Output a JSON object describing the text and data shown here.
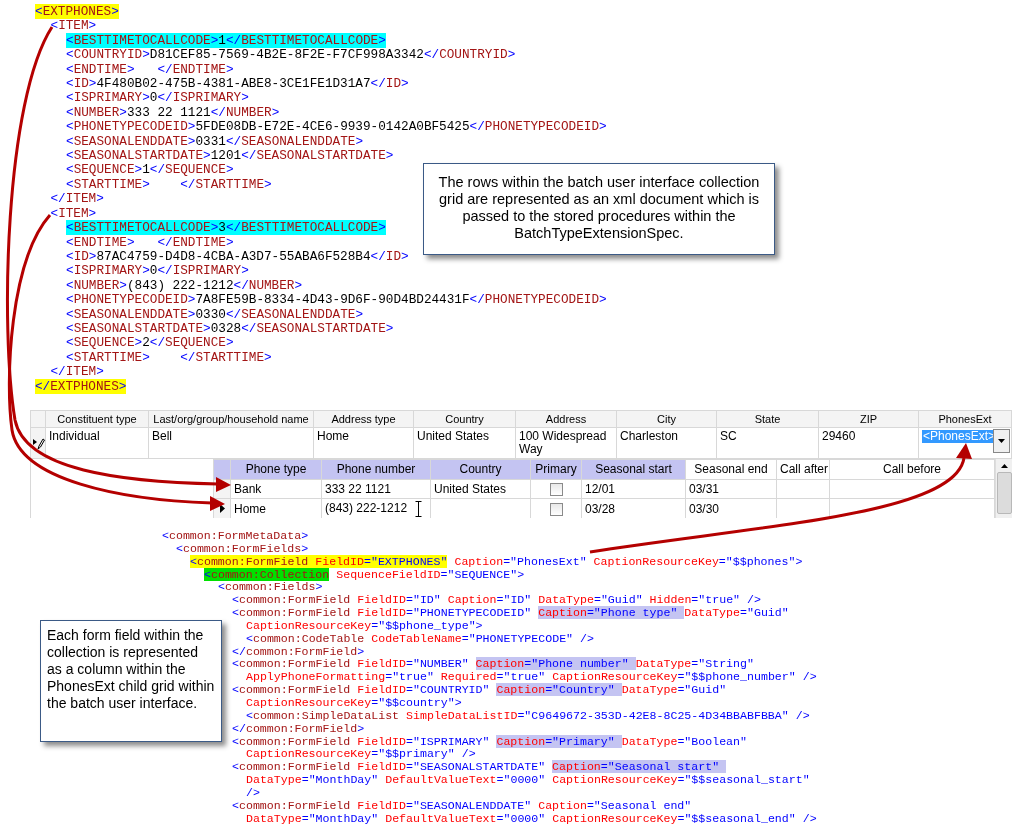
{
  "xml_document": {
    "lines": [
      {
        "parts": [
          {
            "text": "<EXTPHONES>",
            "color": "#ffff00"
          }
        ],
        "close": [
          {
            "text": "</EXTPHONES>",
            "color": "#ffff00"
          }
        ],
        "children": [
          {
            "parts": [
              {
                "text": "<ITEM>"
              }
            ],
            "close": [
              {
                "text": "</ITEM>"
              }
            ],
            "children": [
              {
                "parts": [
                  {
                    "text": "<BESTTIMETOCALLCODE>1</BESTTIMETOCALLCODE>",
                    "color": "#00ffff"
                  }
                ]
              },
              {
                "parts": [
                  {
                    "text": "<COUNTRYID>D81CEF85-7569-4B2E-8F2E-F7CF998A3342</COUNTRYID>"
                  }
                ]
              },
              {
                "parts": [
                  {
                    "text": "<ENDTIME>   </ENDTIME>"
                  }
                ]
              },
              {
                "parts": [
                  {
                    "text": "<ID>4F480B02-475B-4381-ABE8-3CE1FE1D31A7</ID>"
                  }
                ]
              },
              {
                "parts": [
                  {
                    "text": "<ISPRIMARY>0</ISPRIMARY>"
                  }
                ]
              },
              {
                "parts": [
                  {
                    "text": "<NUMBER>333 22 1121</NUMBER>"
                  }
                ]
              },
              {
                "parts": [
                  {
                    "text": "<PHONETYPECODEID>5FDE08DB-E72E-4CE6-9939-0142A0BF5425</PHONETYPECODEID>"
                  }
                ]
              },
              {
                "parts": [
                  {
                    "text": "<SEASONALENDDATE>0331</SEASONALENDDATE>"
                  }
                ]
              },
              {
                "parts": [
                  {
                    "text": "<SEASONALSTARTDATE>1201</SEASONALSTARTDATE>"
                  }
                ]
              },
              {
                "parts": [
                  {
                    "text": "<SEQUENCE>1</SEQUENCE>"
                  }
                ]
              },
              {
                "parts": [
                  {
                    "text": "<STARTTIME>    </STARTTIME>"
                  }
                ]
              }
            ]
          },
          {
            "parts": [
              {
                "text": "<ITEM>"
              }
            ],
            "close": [
              {
                "text": "</ITEM>"
              }
            ],
            "children": [
              {
                "parts": [
                  {
                    "text": "<BESTTIMETOCALLCODE>3</BESTTIMETOCALLCODE>",
                    "color": "#00ffff"
                  }
                ]
              },
              {
                "parts": [
                  {
                    "text": "<ENDTIME>   </ENDTIME>"
                  }
                ]
              },
              {
                "parts": [
                  {
                    "text": "<ID>87AC4759-D4D8-4CBA-A3D7-55ABA6F528B4</ID>"
                  }
                ]
              },
              {
                "parts": [
                  {
                    "text": "<ISPRIMARY>0</ISPRIMARY>"
                  }
                ]
              },
              {
                "parts": [
                  {
                    "text": "<NUMBER>(843) 222-1212</NUMBER>"
                  }
                ]
              },
              {
                "parts": [
                  {
                    "text": "<PHONETYPECODEID>7A8FE59B-8334-4D43-9D6F-90D4BD24431F</PHONETYPECODEID>"
                  }
                ]
              },
              {
                "parts": [
                  {
                    "text": "<SEASONALENDDATE>0330</SEASONALENDDATE>"
                  }
                ]
              },
              {
                "parts": [
                  {
                    "text": "<SEASONALSTARTDATE>0328</SEASONALSTARTDATE>"
                  }
                ]
              },
              {
                "parts": [
                  {
                    "text": "<SEQUENCE>2</SEQUENCE>"
                  }
                ]
              },
              {
                "parts": [
                  {
                    "text": "<STARTTIME>    </STARTTIME>"
                  }
                ]
              }
            ]
          }
        ]
      }
    ]
  },
  "callouts": [
    {
      "kind": "centered",
      "text": "The rows within the batch user interface collection grid are represented as an xml document which is passed to the stored procedures within the BatchTypeExtensionSpec."
    },
    {
      "kind": "left",
      "text": "Each form field within the collection is represented as a column within the PhonesExt child grid within the batch user interface."
    }
  ],
  "batch_grid": {
    "columns": [
      "Constituent type",
      "Last/org/group/household name",
      "Address type",
      "Country",
      "Address",
      "City",
      "State",
      "ZIP",
      "PhonesExt"
    ],
    "rows": [
      {
        "editing": true,
        "cells": [
          {
            "text": "Individual",
            "selected": false
          },
          {
            "text": "Bell",
            "selected": false
          },
          {
            "text": "Home",
            "selected": false
          },
          {
            "text": "United States",
            "selected": false
          },
          {
            "text": "100 Widespread Way",
            "selected": false
          },
          {
            "text": "Charleston",
            "selected": false
          },
          {
            "text": "SC",
            "selected": false
          },
          {
            "text": "29460",
            "selected": false
          },
          {
            "text": "<PhonesExt>",
            "selected": true
          }
        ]
      }
    ],
    "child_grid": {
      "columns": [
        {
          "label": "Phone type",
          "highlighted": true
        },
        {
          "label": "Phone number",
          "highlighted": true
        },
        {
          "label": "Country",
          "highlighted": true
        },
        {
          "label": "Primary",
          "highlighted": true
        },
        {
          "label": "Seasonal start",
          "highlighted": true
        },
        {
          "label": "Seasonal end",
          "highlighted": false
        },
        {
          "label": "Call after",
          "highlighted": false
        },
        {
          "label": "Call before",
          "highlighted": false
        }
      ],
      "rows": [
        {
          "current": false,
          "cells": [
            {
              "kind": "text",
              "text": "Bank"
            },
            {
              "kind": "text",
              "text": "333 22 1121"
            },
            {
              "kind": "text",
              "text": "United States"
            },
            {
              "kind": "checkbox",
              "checked": false
            },
            {
              "kind": "text",
              "text": "12/01"
            },
            {
              "kind": "text",
              "text": "03/31"
            },
            {
              "kind": "empty"
            },
            {
              "kind": "empty"
            }
          ]
        },
        {
          "current": true,
          "cells": [
            {
              "kind": "text",
              "text": "Home"
            },
            {
              "kind": "editing",
              "text": "(843) 222-1212"
            },
            {
              "kind": "empty"
            },
            {
              "kind": "checkbox",
              "checked": false
            },
            {
              "kind": "text",
              "text": "03/28"
            },
            {
              "kind": "text",
              "text": "03/30"
            },
            {
              "kind": "empty"
            },
            {
              "kind": "empty"
            }
          ]
        }
      ]
    }
  },
  "form_metadata_xml": {
    "lines": [
      {
        "parts": [
          {
            "text": "<common:FormMetaData>"
          }
        ],
        "children": [
          {
            "parts": [
              {
                "text": "<common:FormFields>"
              }
            ],
            "children": [
              {
                "parts": [
                  {
                    "text": "<common:FormField FieldID=\"EXTPHONES\"",
                    "color": "#ffff00"
                  },
                  {
                    "text": " Caption=\"PhonesExt\" CaptionResourceKey=\"$$phones\">"
                  }
                ],
                "children": [
                  {
                    "parts": [
                      {
                        "text": "<common:Collection",
                        "color": "#00e000"
                      },
                      {
                        "text": " SequenceFieldID=\"SEQUENCE\">"
                      }
                    ],
                    "children": [
                      {
                        "parts": [
                          {
                            "text": "<common:Fields>"
                          }
                        ],
                        "children": [
                          {
                            "parts": [
                              {
                                "text": "<common:FormField FieldID=\"ID\" Caption=\"ID\" DataType=\"Guid\" Hidden=\"true\" />"
                              }
                            ]
                          },
                          {
                            "parts": [
                              {
                                "text": "<common:FormField FieldID=\"PHONETYPECODEID\" "
                              },
                              {
                                "text": "Caption=\"Phone type\" ",
                                "color": "#c4c4f2"
                              },
                              {
                                "text": "DataType=\"Guid\""
                              }
                            ],
                            "close": [
                              {
                                "text": "</common:FormField>"
                              }
                            ],
                            "children": [
                              {
                                "parts": [
                                  {
                                    "text": "CaptionResourceKey=\"$$phone_type\">"
                                  }
                                ]
                              },
                              {
                                "parts": [
                                  {
                                    "text": "<common:CodeTable CodeTableName=\"PHONETYPECODE\" />"
                                  }
                                ]
                              }
                            ]
                          },
                          {
                            "parts": [
                              {
                                "text": "<common:FormField FieldID=\"NUMBER\" "
                              },
                              {
                                "text": "Caption=\"Phone number\" ",
                                "color": "#c4c4f2"
                              },
                              {
                                "text": "DataType=\"String\""
                              }
                            ],
                            "children": [
                              {
                                "parts": [
                                  {
                                    "text": "ApplyPhoneFormatting=\"true\" Required=\"true\" CaptionResourceKey=\"$$phone_number\" />"
                                  }
                                ]
                              }
                            ]
                          },
                          {
                            "parts": [
                              {
                                "text": "<common:FormField FieldID=\"COUNTRYID\" "
                              },
                              {
                                "text": "Caption=\"Country\" ",
                                "color": "#c4c4f2"
                              },
                              {
                                "text": "DataType=\"Guid\""
                              }
                            ],
                            "close": [
                              {
                                "text": "</common:FormField>"
                              }
                            ],
                            "children": [
                              {
                                "parts": [
                                  {
                                    "text": "CaptionResourceKey=\"$$country\">"
                                  }
                                ]
                              },
                              {
                                "parts": [
                                  {
                                    "text": "<common:SimpleDataList SimpleDataListID=\"C9649672-353D-42E8-8C25-4D34BBABFBBA\" />"
                                  }
                                ]
                              }
                            ]
                          },
                          {
                            "parts": [
                              {
                                "text": "<common:FormField FieldID=\"ISPRIMARY\" "
                              },
                              {
                                "text": "Caption=\"Primary\" ",
                                "color": "#c4c4f2"
                              },
                              {
                                "text": "DataType=\"Boolean\""
                              }
                            ],
                            "children": [
                              {
                                "parts": [
                                  {
                                    "text": "CaptionResourceKey=\"$$primary\" />"
                                  }
                                ]
                              }
                            ]
                          },
                          {
                            "parts": [
                              {
                                "text": "<common:FormField FieldID=\"SEASONALSTARTDATE\" "
                              },
                              {
                                "text": "Caption=\"Seasonal start\" ",
                                "color": "#c4c4f2"
                              }
                            ],
                            "children": [
                              {
                                "parts": [
                                  {
                                    "text": "DataType=\"MonthDay\" DefaultValueText=\"0000\" CaptionResourceKey=\"$$seasonal_start\""
                                  }
                                ]
                              },
                              {
                                "parts": [
                                  {
                                    "text": "/>"
                                  }
                                ]
                              }
                            ]
                          },
                          {
                            "parts": [
                              {
                                "text": "<common:FormField FieldID=\"SEASONALENDDATE\" Caption=\"Seasonal end\""
                              }
                            ],
                            "children": [
                              {
                                "parts": [
                                  {
                                    "text": "DataType=\"MonthDay\" DefaultValueText=\"0000\" CaptionResourceKey=\"$$seasonal_end\" />"
                                  }
                                ]
                              }
                            ]
                          }
                        ]
                      }
                    ]
                  }
                ]
              }
            ]
          }
        ]
      }
    ]
  }
}
